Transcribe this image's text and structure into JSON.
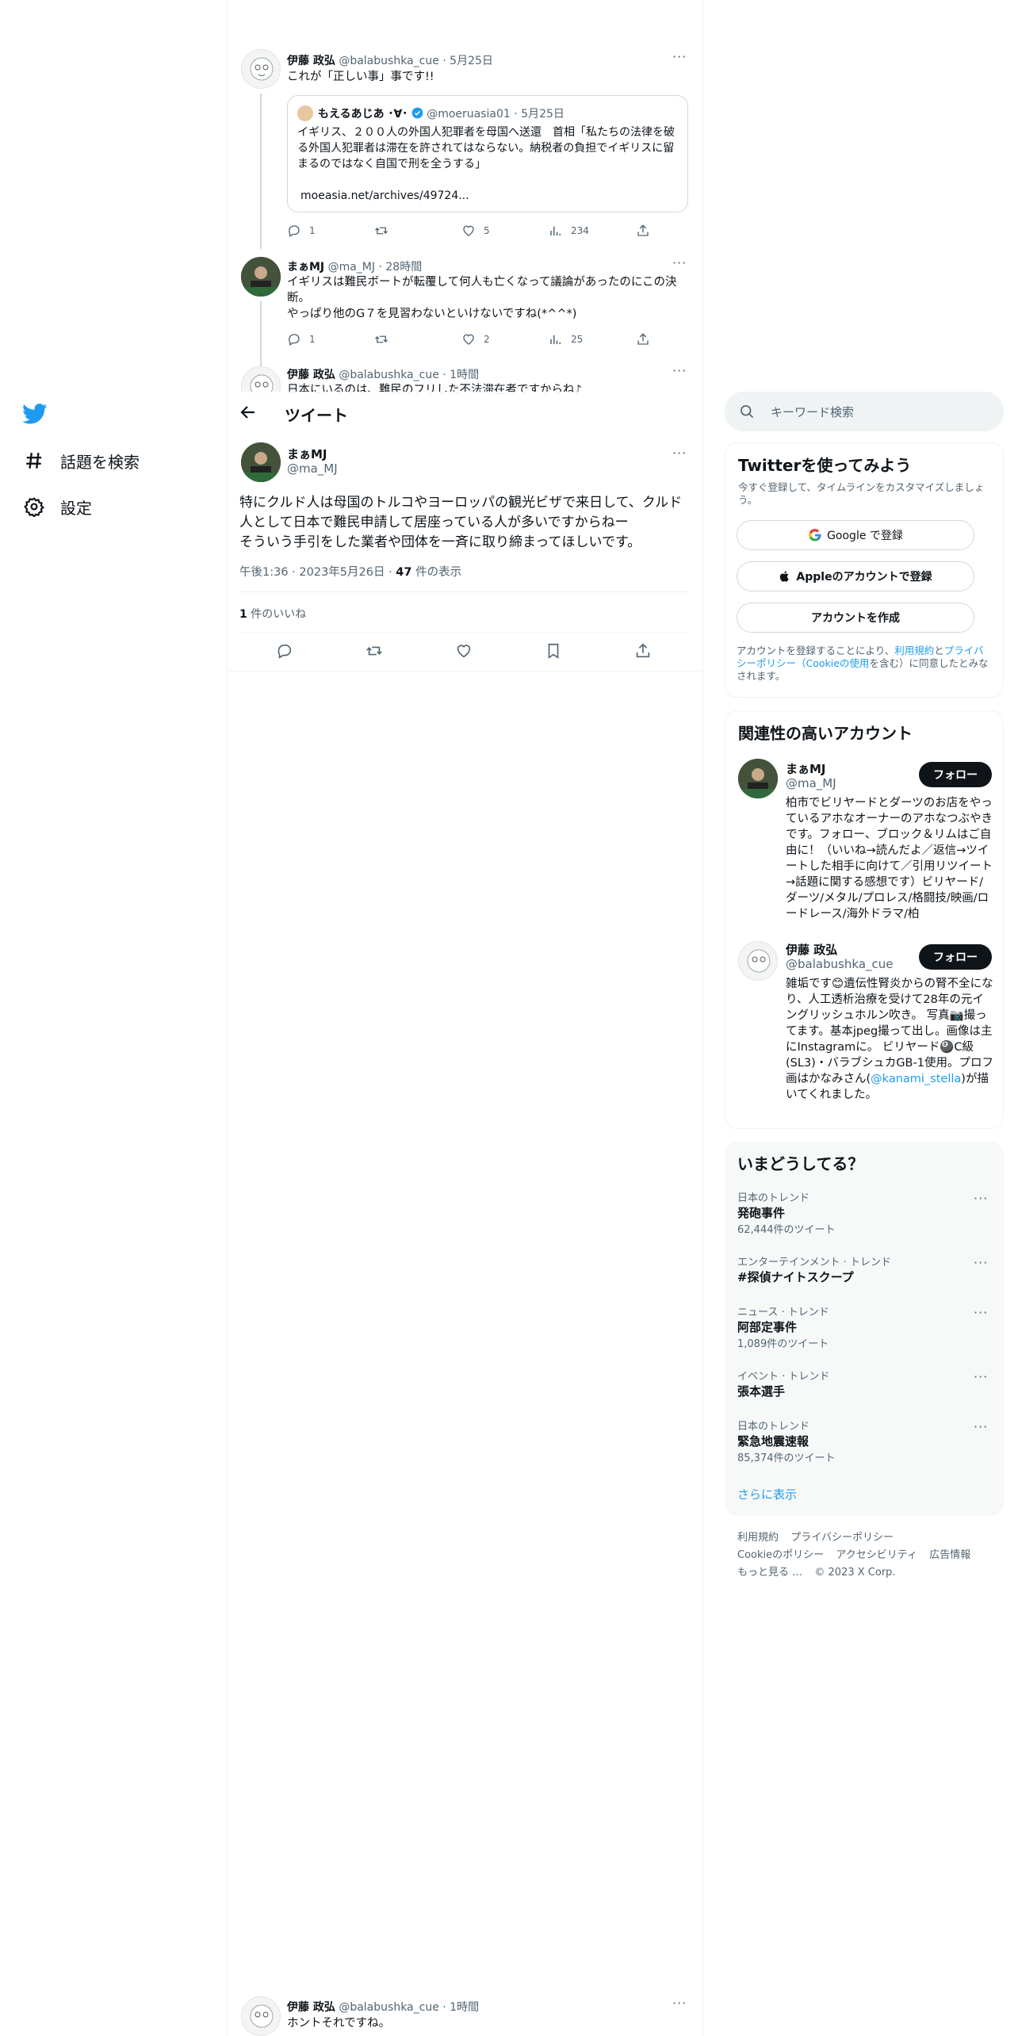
{
  "nav": {
    "explore_label": "話題を検索",
    "settings_label": "設定"
  },
  "header": {
    "title": "ツイート"
  },
  "tweets_above": [
    {
      "name": "伊藤 政弘",
      "handle": "@balabushka_cue",
      "time": "· 5月25日",
      "text": "これが「正しい事」事です!!",
      "quote": {
        "name": "もえるあじあ ･∀･",
        "handle": "@moeruasia01",
        "time": "· 5月25日",
        "text": "イギリス、２００人の外国人犯罪者を母国へ送還　首相「私たちの法律を破る外国人犯罪者は滞在を許されてはならない。納税者の負担でイギリスに留まるのではなく自国で刑を全うする」",
        "link": "moeasia.net/archives/49724..."
      },
      "replies": "1",
      "likes": "5",
      "views": "234"
    },
    {
      "name": "まぁMJ",
      "handle": "@ma_MJ",
      "time": "· 28時間",
      "text_line1": "イギリスは難民ボートが転覆して何人も亡くなって議論があったのにこの決断。",
      "text_line2": "やっぱり他のG７を見習わないといけないですね(*^^*)",
      "replies": "1",
      "likes": "2",
      "views": "25"
    },
    {
      "name": "伊藤 政弘",
      "handle": "@balabushka_cue",
      "time": "· 1時間",
      "text": "日本にいるのは、難民のフリした不法滞在者ですからね♪"
    }
  ],
  "main_tweet": {
    "name": "まぁMJ",
    "handle": "@ma_MJ",
    "text_line1": "特にクルド人は母国のトルコやヨーロッパの観光ビザで来日して、クルド人として日本で難民申請して居座っている人が多いですからねー",
    "text_line2": "そういう手引をした業者や団体を一斉に取り締まってほしいです。",
    "meta_time": "午後1:36 · 2023年5月26日 · ",
    "views_count": "47",
    "views_label": " 件の表示",
    "likes_count": "1",
    "likes_label": " 件のいいね"
  },
  "reply_bottom": {
    "name": "伊藤 政弘",
    "handle": "@balabushka_cue",
    "time": "· 1時間",
    "text": "ホントそれですね。"
  },
  "search": {
    "placeholder": "キーワード検索"
  },
  "signup": {
    "title": "Twitterを使ってみよう",
    "subtitle": "今すぐ登録して、タイムラインをカスタマイズしましょう。",
    "google_label": "Google で登録",
    "apple_label": "Appleのアカウントで登録",
    "create_label": "アカウントを作成",
    "legal_pre": "アカウントを登録することにより、",
    "legal_terms": "利用規約",
    "legal_and": "と",
    "legal_privacy": "プライバシーポリシー（Cookieの使用",
    "legal_post": "を含む）に同意したとみなされます。"
  },
  "related": {
    "title": "関連性の高いアカウント",
    "follow_label": "フォロー",
    "accounts": [
      {
        "name": "まぁMJ",
        "handle": "@ma_MJ",
        "bio": "柏市でビリヤードとダーツのお店をやっているアホなオーナーのアホなつぶやきです。フォロー、ブロック＆リムはご自由に！（いいね→読んだよ／返信→ツイートした相手に向けて／引用リツイート→話題に関する感想です）ビリヤード/ダーツ/メタル/プロレス/格闘技/映画/ロードレース/海外ドラマ/柏"
      },
      {
        "name": "伊藤 政弘",
        "handle": "@balabushka_cue",
        "bio_pre": "雑垢です😊遺伝性腎炎からの腎不全になり、人工透析治療を受けて28年の元イングリッシュホルン吹き。 写真📷撮ってます。基本jpeg撮って出し。画像は主にInstagramに。 ビリヤード🎱C級(SL3)・バラブシュカGB-1使用。プロフ画はかなみさん(",
        "bio_link": "@kanami_stella",
        "bio_post": ")が描いてくれました。"
      }
    ]
  },
  "trends": {
    "title": "いまどうしてる？",
    "items": [
      {
        "category": "日本のトレンド",
        "name": "発砲事件",
        "count": "62,444件のツイート"
      },
      {
        "category": "エンターテインメント · トレンド",
        "name": "#探偵ナイトスクープ",
        "count": ""
      },
      {
        "category": "ニュース · トレンド",
        "name": "阿部定事件",
        "count": "1,089件のツイート"
      },
      {
        "category": "イベント · トレンド",
        "name": "張本選手",
        "count": ""
      },
      {
        "category": "日本のトレンド",
        "name": "緊急地震速報",
        "count": "85,374件のツイート"
      }
    ],
    "show_more": "さらに表示"
  },
  "footer": {
    "terms": "利用規約",
    "privacy": "プライバシーポリシー",
    "cookie": "Cookieのポリシー",
    "accessibility": "アクセシビリティ",
    "ads": "広告情報",
    "more": "もっと見る …",
    "copyright": "© 2023 X Corp."
  },
  "colors": {
    "brand": "#1d9bf0",
    "text": "#0f1419",
    "muted": "#536471",
    "border": "#eff3f4"
  }
}
